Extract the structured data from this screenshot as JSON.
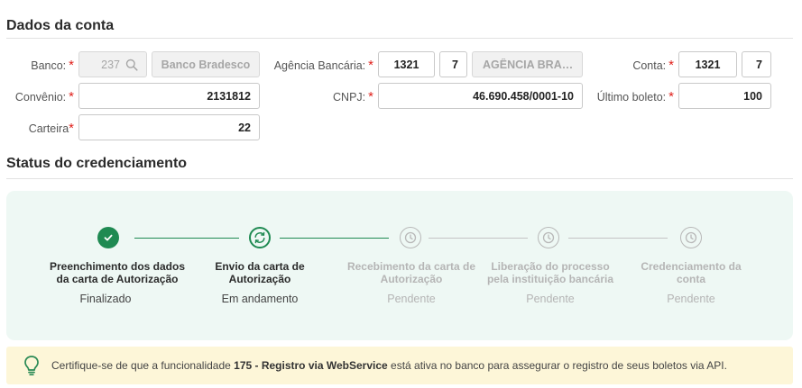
{
  "account": {
    "title": "Dados da conta",
    "bank_label": "Banco:",
    "bank_code": "237",
    "bank_name": "Banco Bradesco",
    "agency_label": "Agência Bancária:",
    "agency_number": "1321",
    "agency_digit": "7",
    "agency_name": "AGÊNCIA BRADES...",
    "account_label": "Conta:",
    "account_number": "1321",
    "account_digit": "7",
    "convenio_label": "Convênio:",
    "convenio_value": "2131812",
    "cnpj_label": "CNPJ:",
    "cnpj_value": "46.690.458/0001-10",
    "last_boleto_label": "Último boleto:",
    "last_boleto_value": "100",
    "carteira_label": "Carteira",
    "carteira_value": "22",
    "required_mark": "*"
  },
  "status": {
    "title": "Status do credenciamento",
    "steps": [
      {
        "line1": "Preenchimento dos dados",
        "line2": "da carta de Autorização",
        "status": "Finalizado",
        "state": "done"
      },
      {
        "line1": "Envio da carta de",
        "line2": "Autorização",
        "status": "Em andamento",
        "state": "active"
      },
      {
        "line1": "Recebimento da carta de",
        "line2": "Autorização",
        "status": "Pendente",
        "state": "pending"
      },
      {
        "line1": "Liberação do processo",
        "line2": "pela instituição bancária",
        "status": "Pendente",
        "state": "pending"
      },
      {
        "line1": "Credenciamento da",
        "line2": "conta",
        "status": "Pendente",
        "state": "pending"
      }
    ]
  },
  "tip": {
    "prefix": "Certifique-se de que a funcionalidade",
    "highlight": "175 - Registro via WebService",
    "suffix": "está ativa no banco para assegurar o registro de seus boletos via API."
  },
  "colors": {
    "accent": "#1f8a52",
    "required": "#e0201b",
    "tip_bg": "#fdf6d8",
    "card_bg": "#eef8f4"
  },
  "icons": [
    "search-icon",
    "check-icon",
    "sync-icon",
    "clock-icon",
    "lightbulb-icon"
  ]
}
